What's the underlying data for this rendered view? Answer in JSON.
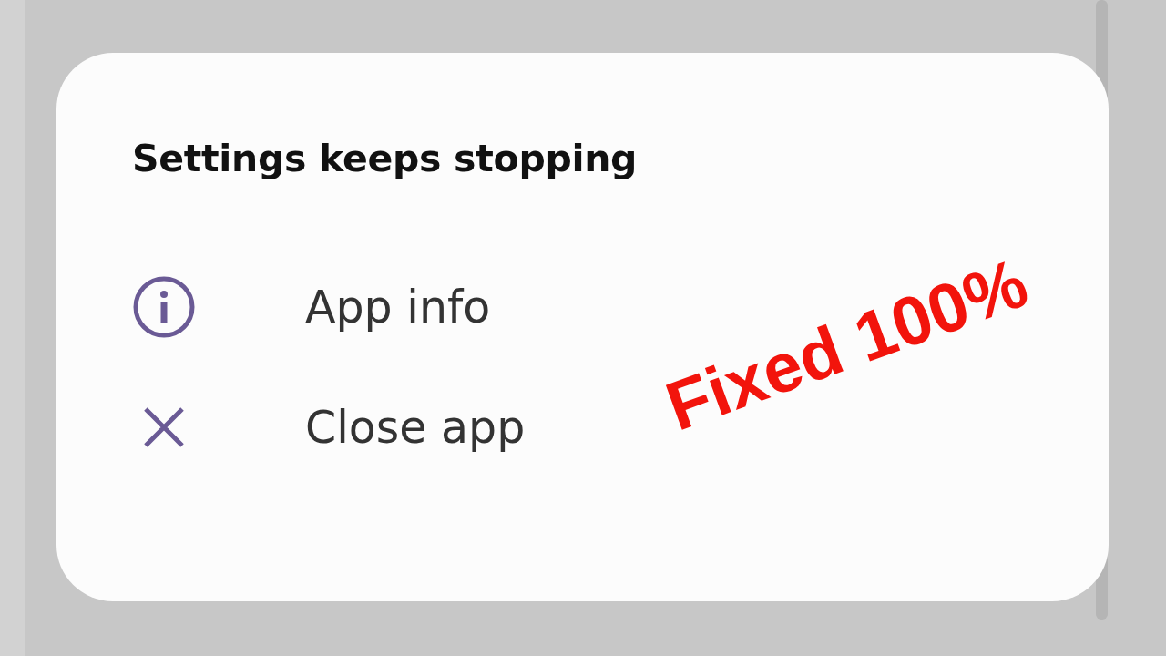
{
  "dialog": {
    "title": "Settings keeps stopping",
    "options": [
      {
        "kind": "info",
        "label": "App info"
      },
      {
        "kind": "close",
        "label": "Close app"
      }
    ]
  },
  "overlay": {
    "text": "Fixed 100%"
  }
}
